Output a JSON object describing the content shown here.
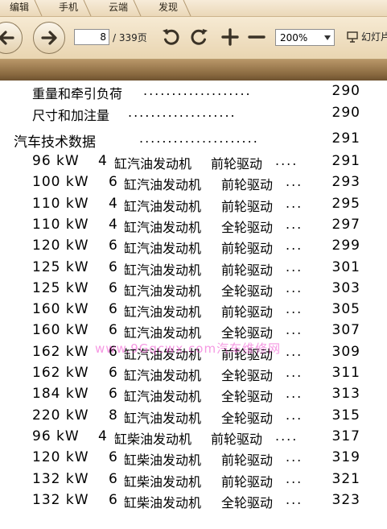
{
  "menu": [
    "编辑",
    "手机",
    "云端",
    "发现"
  ],
  "toolbar": {
    "page_value": "8",
    "page_total": "/ 339页",
    "zoom": "200%",
    "slideshow_label": "幻灯片"
  },
  "toc": {
    "sub1": {
      "title": "重量和牵引负荷",
      "dots": "...................",
      "page": "290"
    },
    "sub2": {
      "title": "尺寸和加注量",
      "dots": "...................",
      "page": "290"
    },
    "chapter": {
      "title": "汽车技术数据",
      "dots": ".....................",
      "page": "291"
    },
    "entries": [
      {
        "power": "96 kW",
        "cyl": "4",
        "engine": "缸汽油发动机",
        "drive": "前轮驱动",
        "dots": "....",
        "page": "291"
      },
      {
        "power": "100 kW",
        "cyl": "6",
        "engine": "缸汽油发动机",
        "drive": "前轮驱动",
        "dots": "...",
        "page": "293"
      },
      {
        "power": "110 kW",
        "cyl": "4",
        "engine": "缸汽油发动机",
        "drive": "前轮驱动",
        "dots": "...",
        "page": "295"
      },
      {
        "power": "110 kW",
        "cyl": "4",
        "engine": "缸汽油发动机",
        "drive": "全轮驱动",
        "dots": "...",
        "page": "297"
      },
      {
        "power": "120 kW",
        "cyl": "6",
        "engine": "缸汽油发动机",
        "drive": "前轮驱动",
        "dots": "...",
        "page": "299"
      },
      {
        "power": "125 kW",
        "cyl": "6",
        "engine": "缸汽油发动机",
        "drive": "前轮驱动",
        "dots": "...",
        "page": "301"
      },
      {
        "power": "125 kW",
        "cyl": "6",
        "engine": "缸汽油发动机",
        "drive": "全轮驱动",
        "dots": "...",
        "page": "303"
      },
      {
        "power": "160 kW",
        "cyl": "6",
        "engine": "缸汽油发动机",
        "drive": "前轮驱动",
        "dots": "...",
        "page": "305"
      },
      {
        "power": "160 kW",
        "cyl": "6",
        "engine": "缸汽油发动机",
        "drive": "全轮驱动",
        "dots": "...",
        "page": "307"
      },
      {
        "power": "162 kW",
        "cyl": "6",
        "engine": "缸汽油发动机",
        "drive": "前轮驱动",
        "dots": "...",
        "page": "309"
      },
      {
        "power": "162 kW",
        "cyl": "6",
        "engine": "缸汽油发动机",
        "drive": "全轮驱动",
        "dots": "...",
        "page": "311"
      },
      {
        "power": "184 kW",
        "cyl": "6",
        "engine": "缸汽油发动机",
        "drive": "全轮驱动",
        "dots": "...",
        "page": "313"
      },
      {
        "power": "220 kW",
        "cyl": "8",
        "engine": "缸汽油发动机",
        "drive": "全轮驱动",
        "dots": "...",
        "page": "315"
      },
      {
        "power": "96 kW",
        "cyl": "4",
        "engine": "缸柴油发动机",
        "drive": "前轮驱动",
        "dots": "....",
        "page": "317"
      },
      {
        "power": "120 kW",
        "cyl": "6",
        "engine": "缸柴油发动机",
        "drive": "前轮驱动",
        "dots": "...",
        "page": "319"
      },
      {
        "power": "132 kW",
        "cyl": "6",
        "engine": "缸柴油发动机",
        "drive": "前轮驱动",
        "dots": "...",
        "page": "321"
      },
      {
        "power": "132 kW",
        "cyl": "6",
        "engine": "缸柴油发动机",
        "drive": "全轮驱动",
        "dots": "...",
        "page": "323"
      }
    ]
  },
  "watermark": "www.9Gqcwx.com汽车维修网",
  "colors": {
    "toolbar_bg": "#efdfc2",
    "band": "#8a6a40",
    "watermark": "#ee44cc"
  }
}
